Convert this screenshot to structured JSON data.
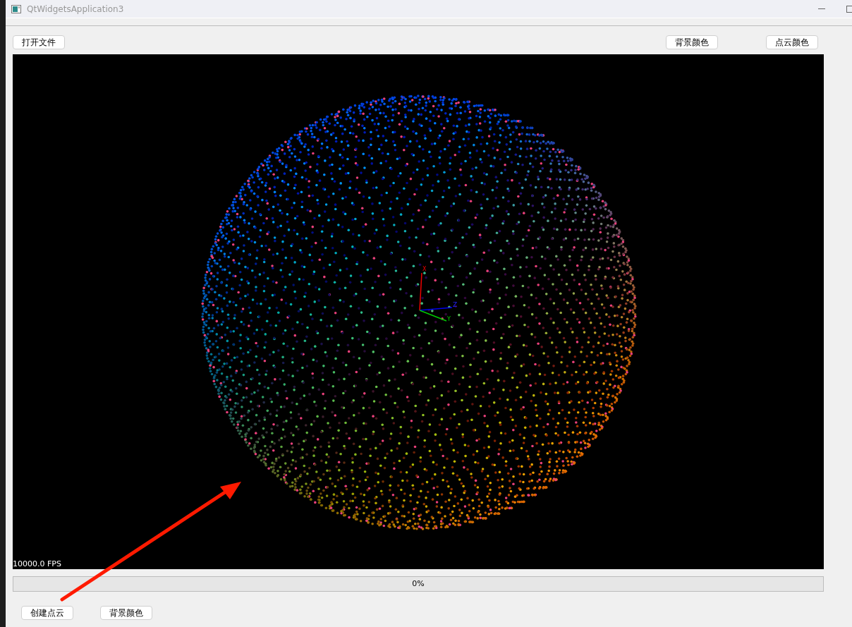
{
  "window": {
    "title": "QtWidgetsApplication3"
  },
  "toolbar": {
    "left_buttons": [
      "打开文件"
    ],
    "right_buttons": [
      "背景颜色",
      "点云颜色"
    ]
  },
  "viewport": {
    "axis_labels": [
      "X",
      "Y",
      "Z"
    ],
    "fps": "10000.0 FPS"
  },
  "progress": {
    "level": 0,
    "text": "0%"
  },
  "bottom_buttons": [
    "创建点云",
    "背景颜色"
  ]
}
